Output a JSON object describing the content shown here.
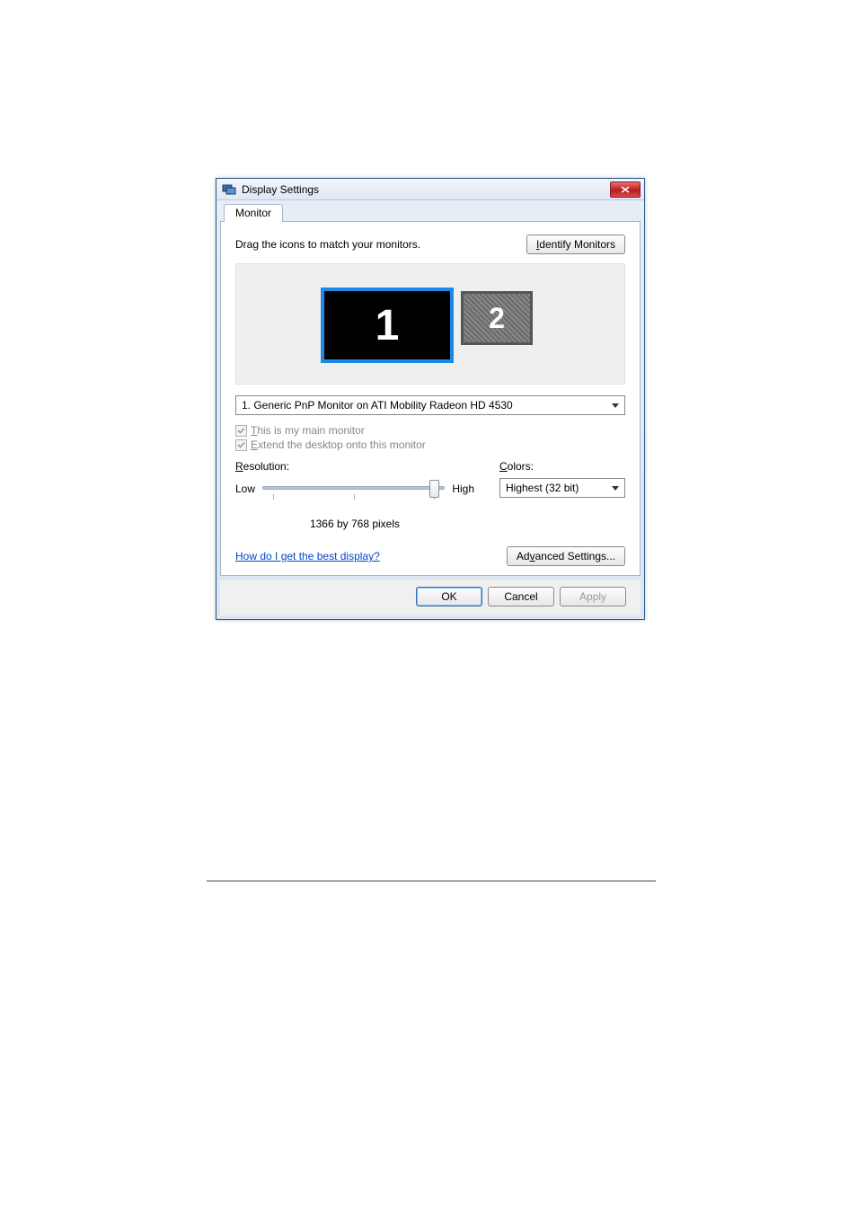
{
  "window": {
    "title": "Display Settings"
  },
  "tab": {
    "label": "Monitor"
  },
  "instruction": "Drag the icons to match your monitors.",
  "buttons": {
    "identify": "Identify Monitors",
    "identify_accel": "I",
    "advanced": "Advanced Settings...",
    "advanced_accel": "v",
    "ok": "OK",
    "cancel": "Cancel",
    "apply": "Apply"
  },
  "monitors": {
    "m1": "1",
    "m2": "2"
  },
  "monitor_select": {
    "value": "1. Generic PnP Monitor on ATI Mobility Radeon HD 4530"
  },
  "checkboxes": {
    "main_prefix": "T",
    "main_rest": "his is my main monitor",
    "extend_prefix": "E",
    "extend_rest": "xtend the desktop onto this monitor"
  },
  "resolution": {
    "label_prefix": "R",
    "label_rest": "esolution:",
    "low": "Low",
    "high": "High",
    "value": "1366 by 768 pixels"
  },
  "colors": {
    "label_prefix": "C",
    "label_rest": "olors:",
    "value": "Highest (32 bit)"
  },
  "help_link": "How do I get the best display?"
}
